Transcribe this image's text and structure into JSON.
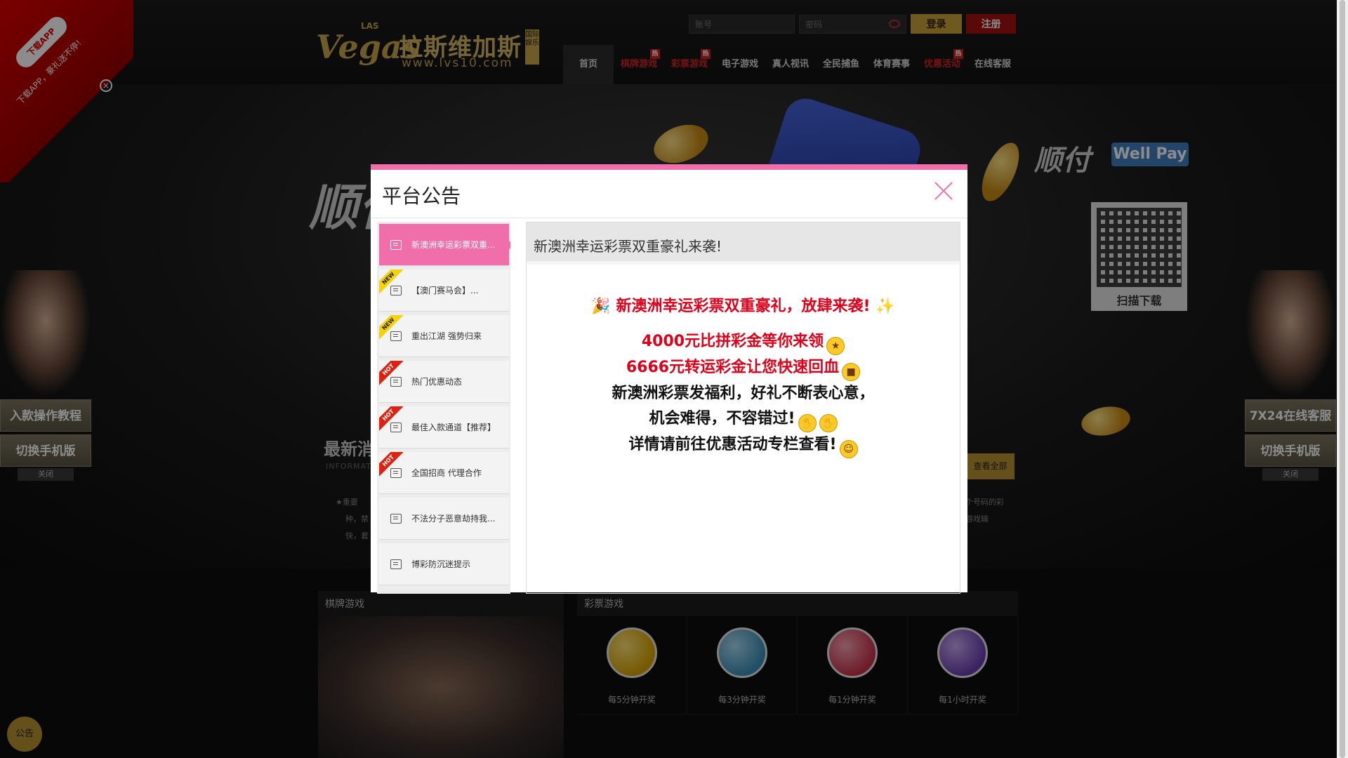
{
  "header": {
    "logo_script": "Vegas",
    "logo_small": "LAS",
    "logo_cn": "拉斯维加斯",
    "logo_url": "www.lvs10.com",
    "logo_badge": "国际娱乐",
    "account_placeholder": "账号",
    "password_placeholder": "密码",
    "login_label": "登录",
    "register_label": "注册"
  },
  "nav": {
    "items": [
      {
        "label": "首页",
        "active": true
      },
      {
        "label": "棋牌游戏",
        "hot": "热"
      },
      {
        "label": "彩票游戏",
        "hot": "热"
      },
      {
        "label": "电子游戏"
      },
      {
        "label": "真人视讯"
      },
      {
        "label": "全民捕鱼"
      },
      {
        "label": "体育赛事"
      },
      {
        "label": "优惠活动",
        "hot": "热"
      },
      {
        "label": "在线客服"
      }
    ]
  },
  "ribbon": {
    "pill": "下载APP",
    "text": "下载APP，豪礼送不停!"
  },
  "banner": {
    "wellpay": "Well Pay",
    "shunfu": "顺付",
    "qr_caption": "扫描下载"
  },
  "news": {
    "title": "最新消",
    "subtitle": "INFORMATI",
    "view_all": "查看全部",
    "left_text": "★重要",
    "left_text2": "种，禁",
    "left_text3": "快，套",
    "right_text": "个号码的彩",
    "right_text2": "游戏输"
  },
  "side_left": {
    "button1": "入款操作教程",
    "button2": "切换手机版",
    "close": "关闭"
  },
  "side_right": {
    "button1": "7X24在线客服",
    "button2": "切换手机版",
    "close": "关闭"
  },
  "sections": {
    "qipai": "棋牌游戏",
    "caipiao": "彩票游戏"
  },
  "lottery": [
    {
      "caption": "每5分钟开奖",
      "color": "#d8a200"
    },
    {
      "caption": "每3分钟开奖",
      "color": "#3a8fb8"
    },
    {
      "caption": "每1分钟开奖",
      "color": "#c8334a"
    },
    {
      "caption": "每1小时开奖",
      "color": "#6a3fb0"
    }
  ],
  "notice_button": "公告",
  "modal": {
    "title": "平台公告",
    "items": [
      {
        "label": "新澳洲幸运彩票双重...",
        "active": true,
        "tag": ""
      },
      {
        "label": "【澳门赛马会】...",
        "tag": "NEW"
      },
      {
        "label": "重出江湖 强势归来",
        "tag": "NEW"
      },
      {
        "label": "热门优惠动态",
        "tag": "HOT"
      },
      {
        "label": "最佳入款通道【推荐】",
        "tag": "HOT"
      },
      {
        "label": "全国招商 代理合作",
        "tag": "HOT"
      },
      {
        "label": "不法分子恶意劫持我...",
        "tag": ""
      },
      {
        "label": "博彩防沉迷提示",
        "tag": ""
      }
    ],
    "content_title": "新澳洲幸运彩票双重豪礼来袭!",
    "lines": [
      {
        "text": "新澳洲幸运彩票双重豪礼，放肆来袭!",
        "style": "red"
      },
      {
        "text": "4000元比拼彩金等你来领",
        "style": "red"
      },
      {
        "text": "6666元转运彩金让您快速回血",
        "style": "red"
      },
      {
        "text": "新澳洲彩票发福利，好礼不断表心意，",
        "style": "dark"
      },
      {
        "text": "机会难得，不容错过!",
        "style": "dark"
      },
      {
        "text": "详情请前往优惠活动专栏查看!",
        "style": "dark"
      }
    ]
  }
}
